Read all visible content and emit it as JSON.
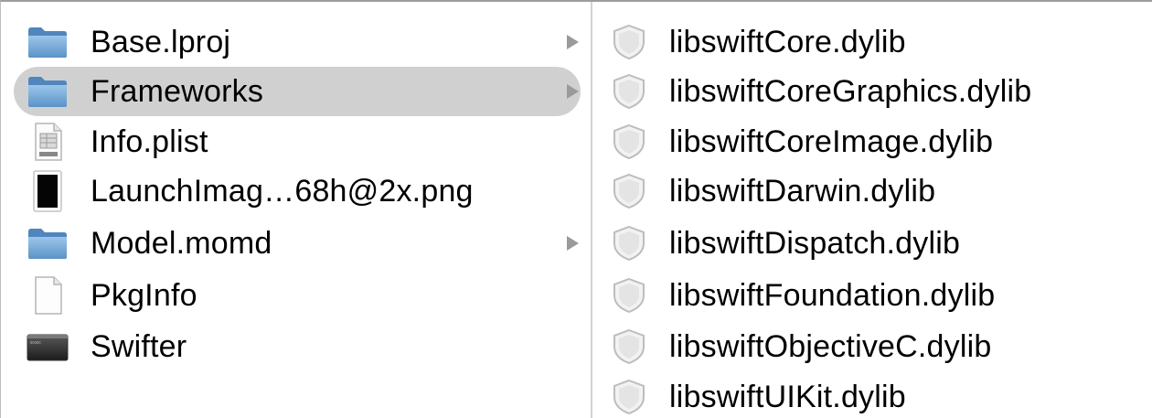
{
  "left_column": {
    "items": [
      {
        "label": "Base.lproj",
        "icon": "folder-icon",
        "has_children": true
      },
      {
        "label": "Frameworks",
        "icon": "folder-icon",
        "has_children": true,
        "selected": true
      },
      {
        "label": "Info.plist",
        "icon": "plist-file-icon",
        "has_children": false
      },
      {
        "label": "LaunchImag…68h@2x.png",
        "icon": "image-file-icon",
        "has_children": false
      },
      {
        "label": "Model.momd",
        "icon": "folder-icon",
        "has_children": true
      },
      {
        "label": "PkgInfo",
        "icon": "document-icon",
        "has_children": false
      },
      {
        "label": "Swifter",
        "icon": "executable-icon",
        "has_children": false
      }
    ]
  },
  "right_column": {
    "items": [
      {
        "label": "libswiftCore.dylib",
        "icon": "dylib-shield-icon"
      },
      {
        "label": "libswiftCoreGraphics.dylib",
        "icon": "dylib-shield-icon"
      },
      {
        "label": "libswiftCoreImage.dylib",
        "icon": "dylib-shield-icon"
      },
      {
        "label": "libswiftDarwin.dylib",
        "icon": "dylib-shield-icon"
      },
      {
        "label": "libswiftDispatch.dylib",
        "icon": "dylib-shield-icon"
      },
      {
        "label": "libswiftFoundation.dylib",
        "icon": "dylib-shield-icon"
      },
      {
        "label": "libswiftObjectiveC.dylib",
        "icon": "dylib-shield-icon"
      },
      {
        "label": "libswiftUIKit.dylib",
        "icon": "dylib-shield-icon"
      }
    ]
  },
  "colors": {
    "selection": "#d0d0d0",
    "folder": "#6fa6d6",
    "chevron": "#9a9a9a"
  }
}
